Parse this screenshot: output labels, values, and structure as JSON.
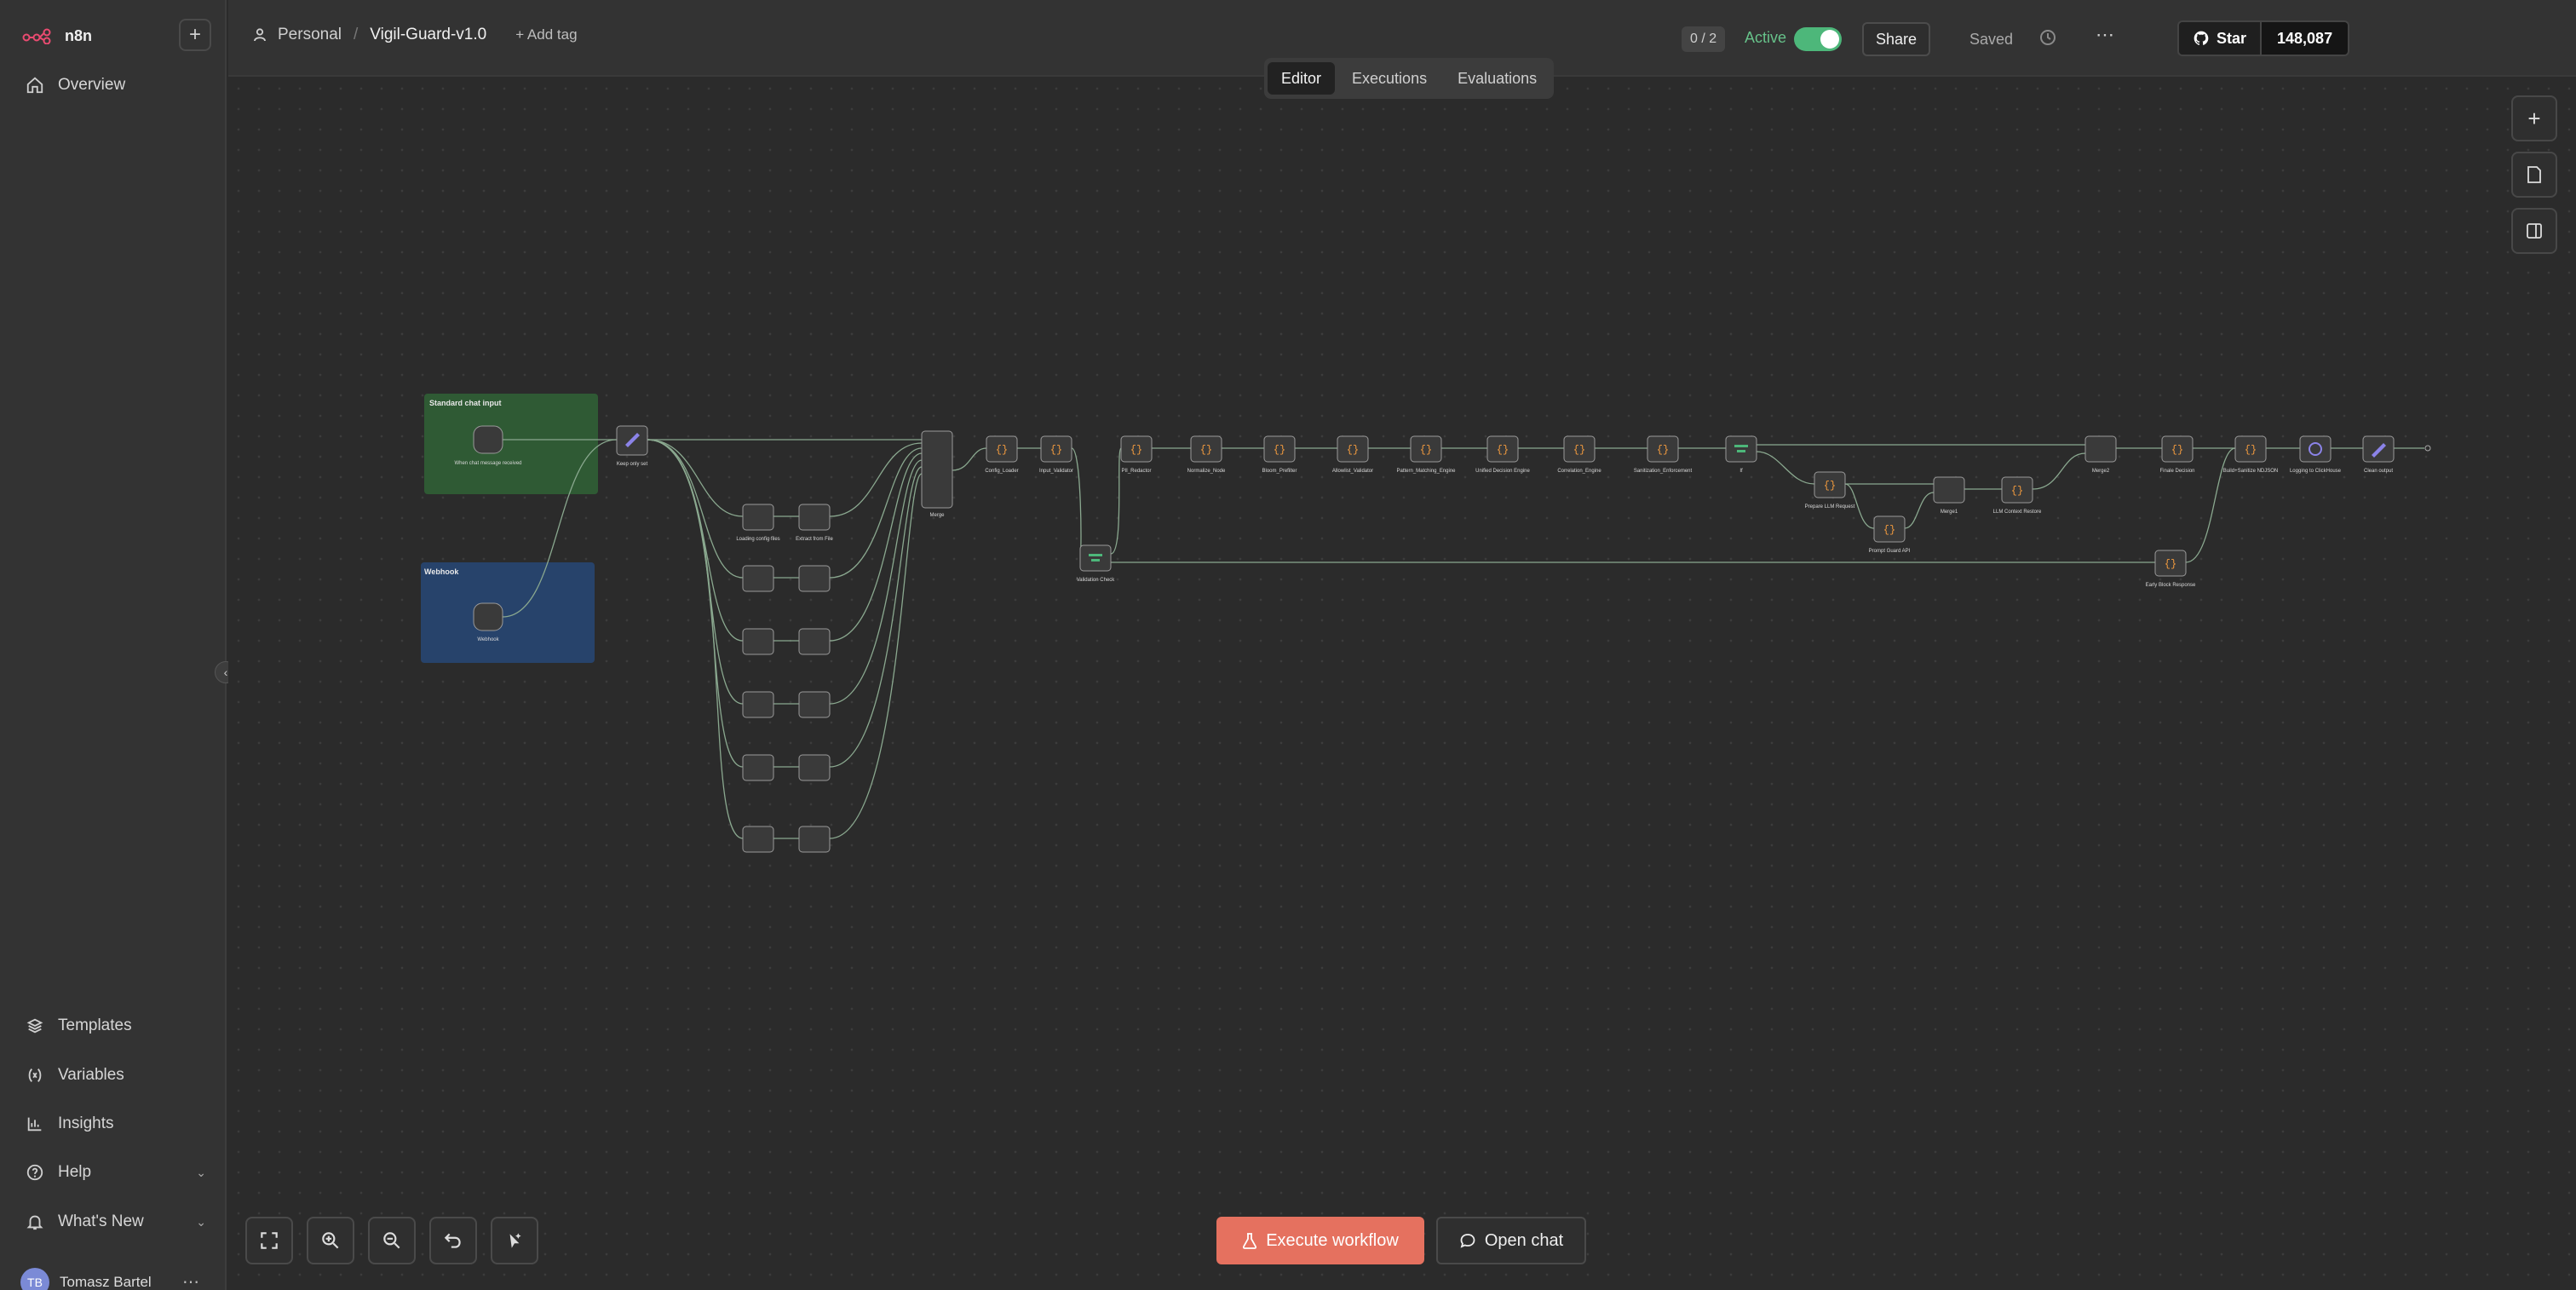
{
  "app": {
    "brand": "n8n"
  },
  "sidebar": {
    "new_button": "+",
    "overview": "Overview",
    "bottom_items": [
      {
        "label": "Templates",
        "icon": "templates-icon"
      },
      {
        "label": "Variables",
        "icon": "variables-icon"
      },
      {
        "label": "Insights",
        "icon": "insights-icon"
      },
      {
        "label": "Help",
        "icon": "help-icon"
      },
      {
        "label": "What's New",
        "icon": "bell-icon"
      }
    ],
    "user": {
      "initials": "TB",
      "name": "Tomasz Bartel"
    }
  },
  "header": {
    "project": "Personal",
    "workflow_name": "Vigil-Guard-v1.0",
    "add_tag": "+ Add tag",
    "exec_count": "0 / 2",
    "active_label": "Active",
    "share": "Share",
    "saved": "Saved",
    "github_star": "Star",
    "github_count": "148,087"
  },
  "tabs": [
    "Editor",
    "Executions",
    "Evaluations"
  ],
  "canvas": {
    "stickies": [
      "Standard chat input",
      "Webhook"
    ],
    "nodes": [
      "When chat message received",
      "Webhook",
      "Keep only set",
      "Merge",
      "Loading config files",
      "Extract from File",
      "Config_Loader",
      "Input_Validator",
      "Validation Check",
      "PII_Redactor",
      "Normalize_Node",
      "Bloom_Prefilter",
      "Allowlist_Validator",
      "Pattern_Matching_Engine",
      "Unified Decision Engine",
      "Correlation_Engine",
      "Sanitization_Enforcement",
      "If",
      "Prepare LLM Request",
      "Prompt Guard API",
      "Merge1",
      "LLM Context Restore",
      "Merge2",
      "Finale Decision",
      "Build+Sanitize NDJSON",
      "Logging to ClickHouse",
      "Clean output",
      "Early Block Response"
    ]
  },
  "controls": {
    "execute": "Execute workflow",
    "open_chat": "Open chat"
  }
}
